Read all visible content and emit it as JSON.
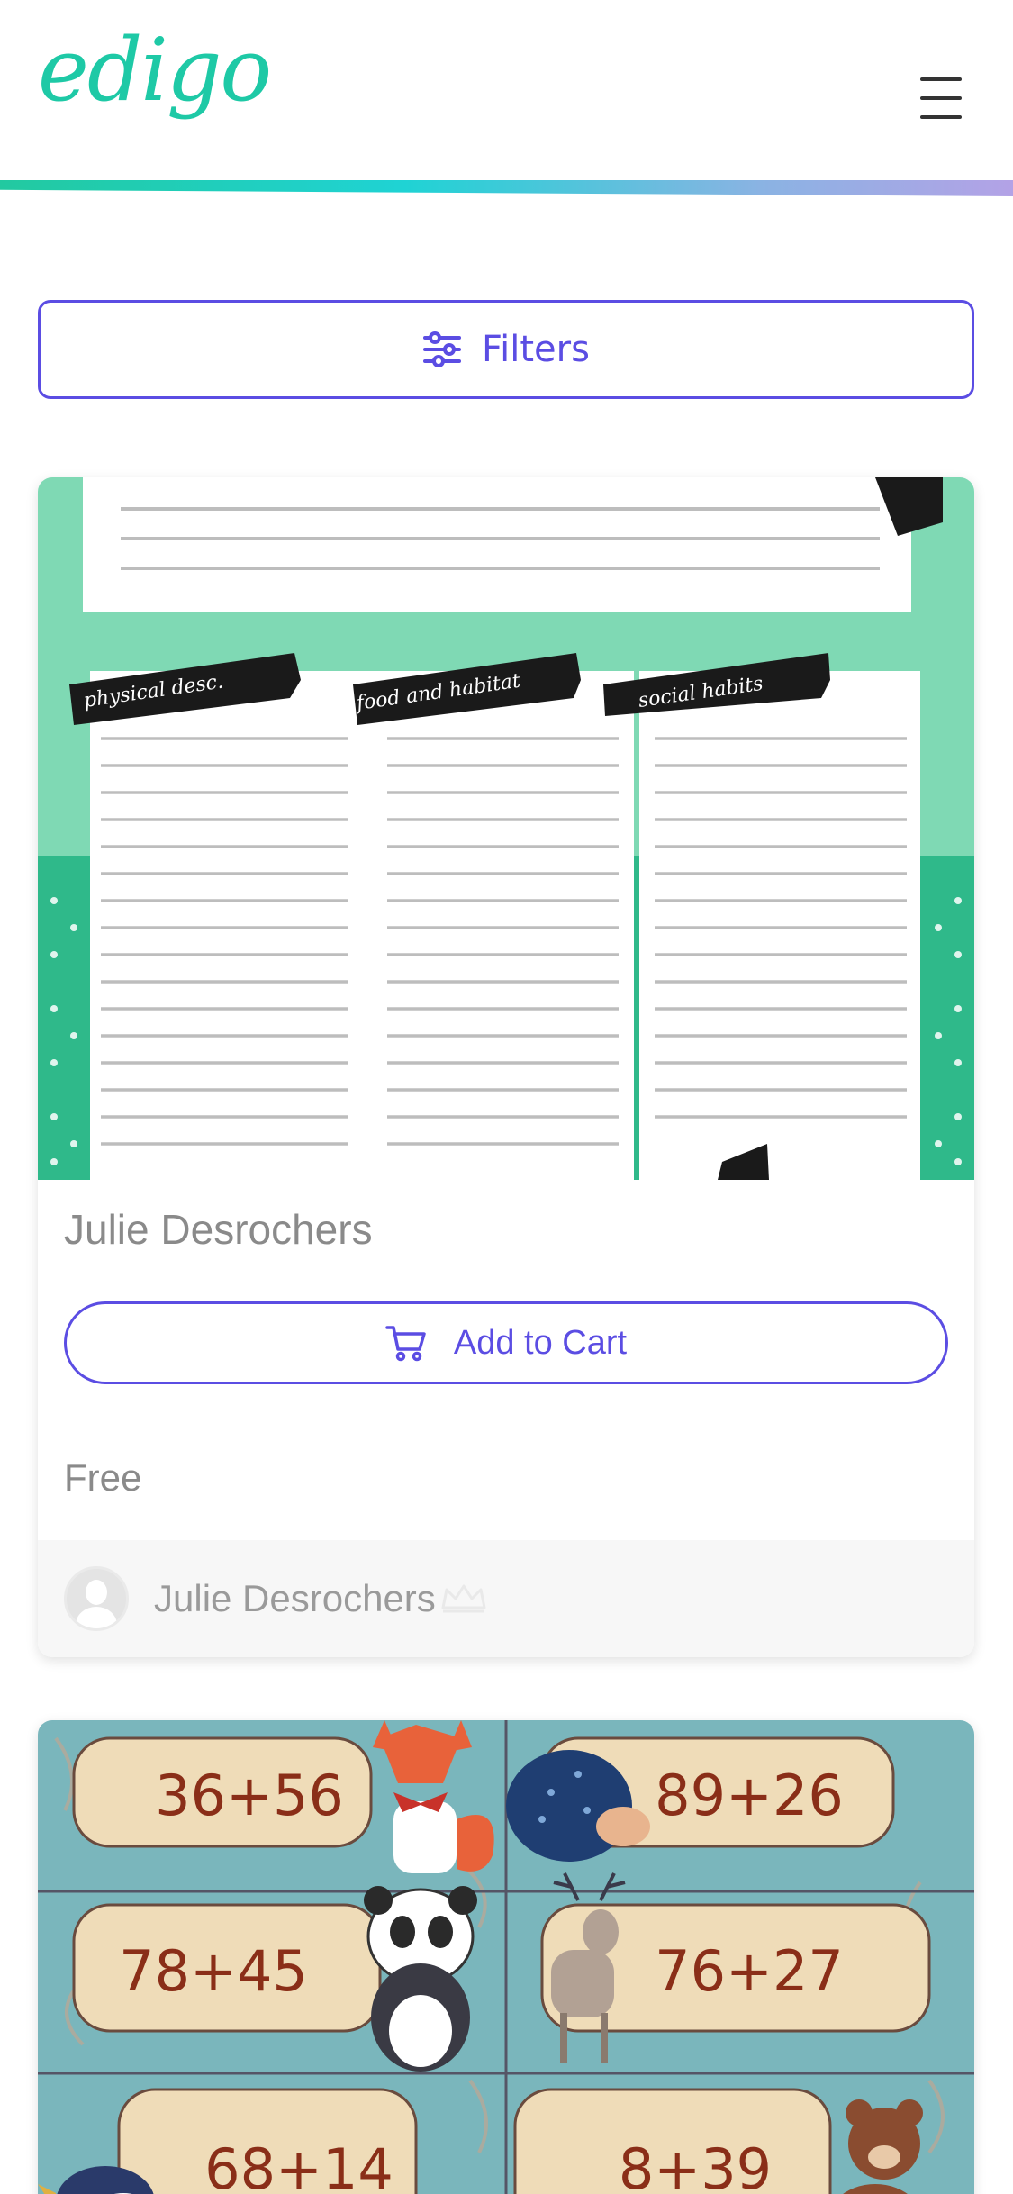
{
  "header": {
    "logo": "edigo",
    "menu_icon": "hamburger-menu-icon"
  },
  "colors": {
    "brand": "#1ec9a6",
    "accent": "#5b4de3",
    "gradient": [
      "#22c9a0",
      "#1fd3d4",
      "#8ab3e3",
      "#b3a2e6"
    ]
  },
  "filters": {
    "label": "Filters",
    "icon": "sliders-icon"
  },
  "products": [
    {
      "title": "Julie Desrochers",
      "cart_label": "Add to Cart",
      "cart_icon": "cart-icon",
      "price": "Free",
      "author": "Julie Desrochers",
      "author_badge_icon": "crown-icon",
      "thumbnail": {
        "banner_labels": [
          "physical desc.",
          "food and habitat",
          "social habits"
        ]
      }
    },
    {
      "thumbnail": {
        "problems": [
          "36+56",
          "89+26",
          "78+45",
          "76+27",
          "68+14",
          "8+39"
        ]
      }
    }
  ]
}
